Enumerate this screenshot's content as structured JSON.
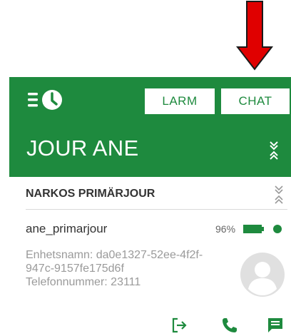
{
  "header": {
    "larm_label": "LARM",
    "chat_label": "CHAT",
    "title": "JOUR ANE"
  },
  "section": {
    "title": "NARKOS PRIMÄRJOUR"
  },
  "user": {
    "name": "ane_primarjour",
    "battery": "96%",
    "device_line1": "Enhetsnamn: da0e1327-52ee-4f2f-",
    "device_line2": "947c-9157fe175d6f",
    "phone": "Telefonnummer: 23111"
  },
  "icons": {
    "logo": "history-clock-icon",
    "collapse": "collapse-icon",
    "battery": "battery-icon",
    "status": "status-dot",
    "avatar": "avatar-icon",
    "logout": "logout-icon",
    "call": "phone-icon",
    "chat": "chat-icon",
    "arrow": "red-arrow-icon"
  },
  "colors": {
    "brand": "#1e8a3e",
    "arrow": "#e00000"
  }
}
